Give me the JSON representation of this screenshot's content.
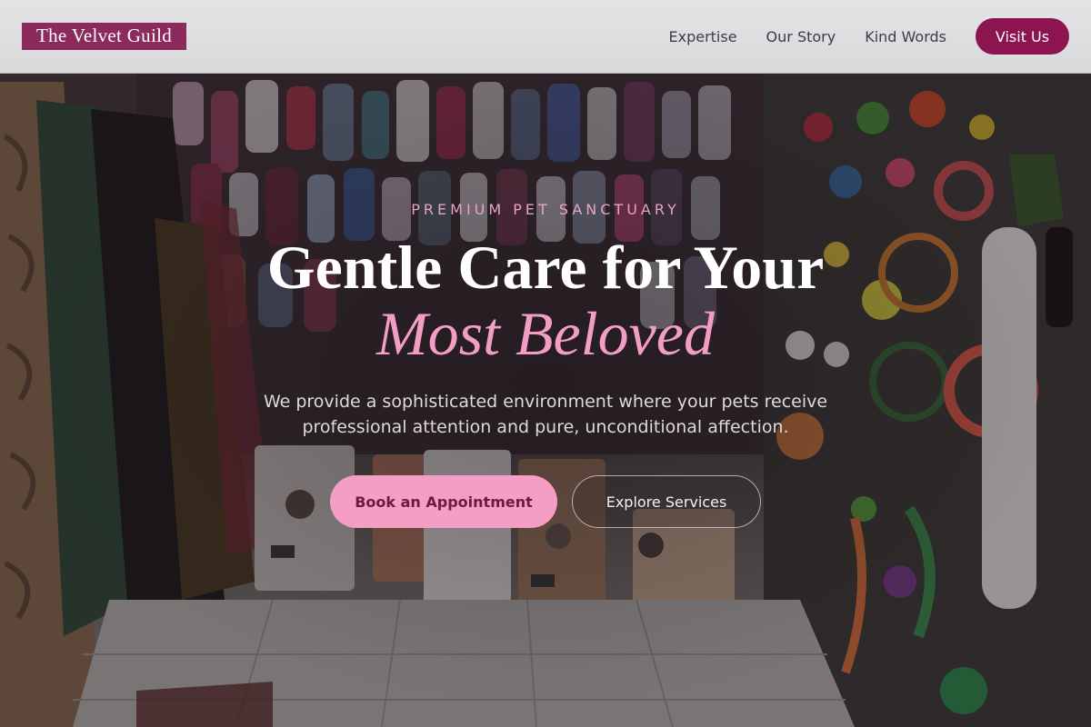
{
  "brand": {
    "name": "The Velvet Guild",
    "color": "#8c2a5c"
  },
  "nav": {
    "items": [
      {
        "label": "Expertise"
      },
      {
        "label": "Our Story"
      },
      {
        "label": "Kind Words"
      }
    ],
    "cta_label": "Visit Us",
    "cta_color": "#8c1550"
  },
  "hero": {
    "eyebrow": "PREMIUM PET SANCTUARY",
    "headline": "Gentle Care for Your",
    "headline_accent": "Most Beloved",
    "subtitle": "We provide a sophisticated environment where your pets receive professional attention and pure, unconditional affection.",
    "primary_button": "Book an Appointment",
    "secondary_button": "Explore Services",
    "accent_color": "#f49ec5",
    "background": "pet shop interior with hanging pet clothes, toys and cat food bags"
  }
}
